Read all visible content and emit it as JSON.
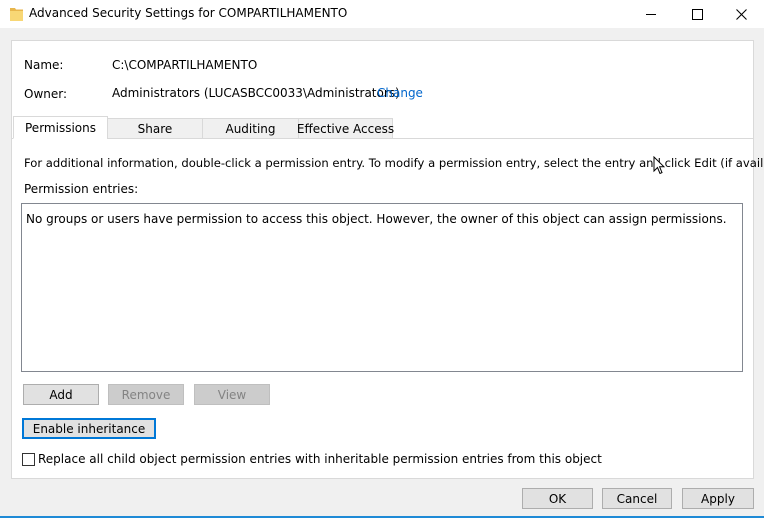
{
  "window": {
    "title": "Advanced Security Settings for COMPARTILHAMENTO",
    "folder_icon": "folder-icon",
    "controls": [
      "minimize-icon",
      "maximize-icon",
      "close-icon"
    ]
  },
  "info": {
    "name_label": "Name:",
    "name_value": "C:\\COMPARTILHAMENTO",
    "owner_label": "Owner:",
    "owner_value": "Administrators (LUCASBCC0033\\Administrators)",
    "change_link": "Change"
  },
  "tabs": [
    {
      "label": "Permissions",
      "active": true
    },
    {
      "label": "Share",
      "active": false
    },
    {
      "label": "Auditing",
      "active": false
    },
    {
      "label": "Effective Access",
      "active": false
    }
  ],
  "permissions": {
    "instructions": "For additional information, double-click a permission entry. To modify a permission entry, select the entry and click Edit (if available).",
    "entries_label": "Permission entries:",
    "empty_message": "No groups or users have permission to access this object. However, the owner of this object can assign permissions.",
    "add_label": "Add",
    "remove_label": "Remove",
    "view_label": "View",
    "enable_inheritance_label": "Enable inheritance",
    "replace_checkbox_label": "Replace all child object permission entries with inheritable permission entries from this object",
    "replace_checked": false
  },
  "footer": {
    "ok_label": "OK",
    "cancel_label": "Cancel",
    "apply_label": "Apply"
  },
  "colors": {
    "accent": "#0078d7",
    "link": "#0066cc",
    "folder": "#f8d775"
  }
}
